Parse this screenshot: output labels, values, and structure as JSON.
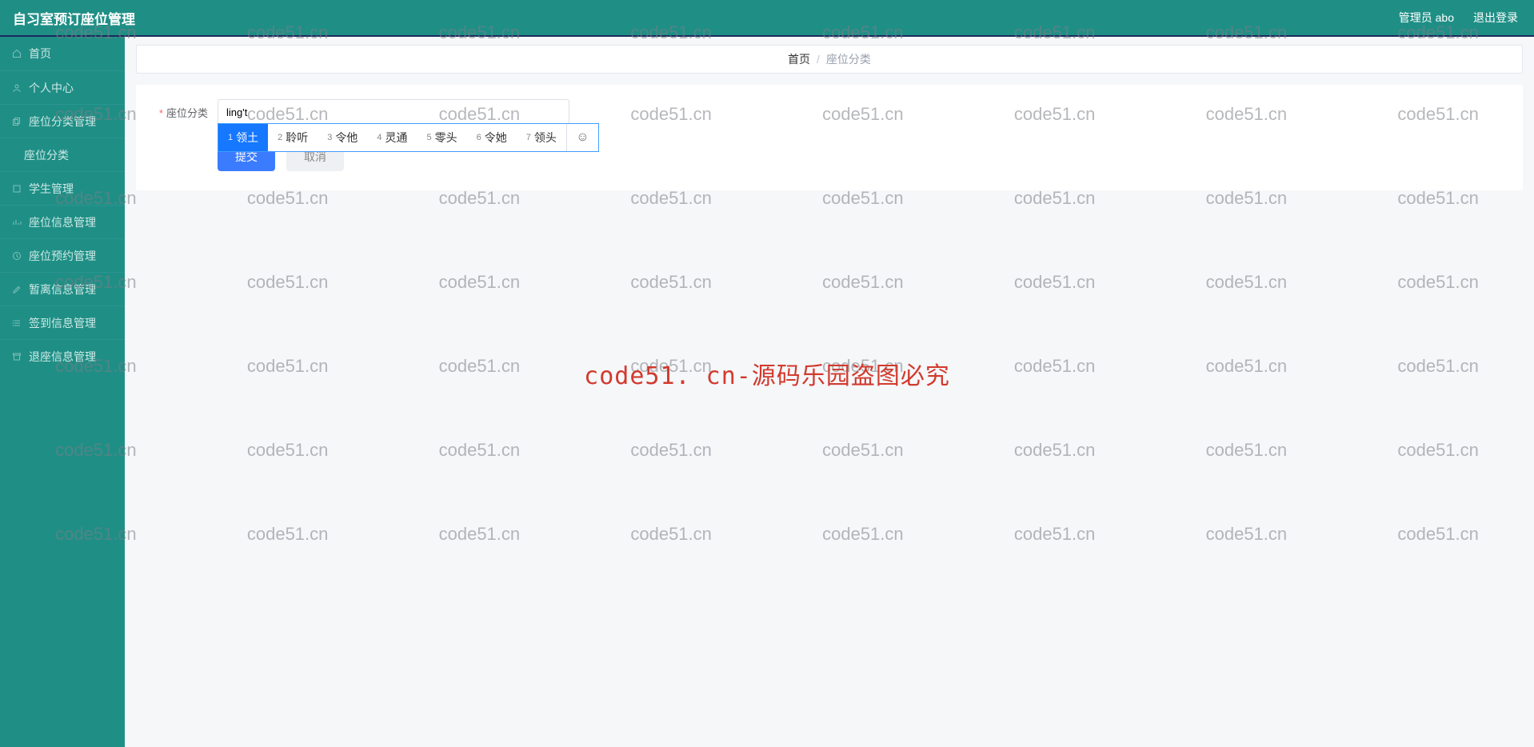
{
  "topbar": {
    "title": "自习室预订座位管理",
    "admin_label": "管理员 abo",
    "logout_label": "退出登录"
  },
  "sidebar": {
    "items": [
      {
        "label": "首页",
        "icon": "home"
      },
      {
        "label": "个人中心",
        "icon": "user"
      },
      {
        "label": "座位分类管理",
        "icon": "copy"
      },
      {
        "label": "座位分类",
        "icon": "",
        "child": true
      },
      {
        "label": "学生管理",
        "icon": "box"
      },
      {
        "label": "座位信息管理",
        "icon": "bars"
      },
      {
        "label": "座位预约管理",
        "icon": "clock"
      },
      {
        "label": "暂离信息管理",
        "icon": "edit"
      },
      {
        "label": "签到信息管理",
        "icon": "list"
      },
      {
        "label": "退座信息管理",
        "icon": "archive"
      }
    ]
  },
  "breadcrumb": {
    "home": "首页",
    "current": "座位分类"
  },
  "form": {
    "label": "座位分类",
    "input_value": "ling't",
    "submit_label": "提交",
    "cancel_label": "取消"
  },
  "ime": {
    "candidates": [
      {
        "n": "1",
        "text": "领土"
      },
      {
        "n": "2",
        "text": "聆听"
      },
      {
        "n": "3",
        "text": "令他"
      },
      {
        "n": "4",
        "text": "灵通"
      },
      {
        "n": "5",
        "text": "零头"
      },
      {
        "n": "6",
        "text": "令她"
      },
      {
        "n": "7",
        "text": "领头"
      }
    ],
    "emoji": "☺"
  },
  "watermark": {
    "text": "code51.cn",
    "center": "code51. cn-源码乐园盗图必究"
  }
}
